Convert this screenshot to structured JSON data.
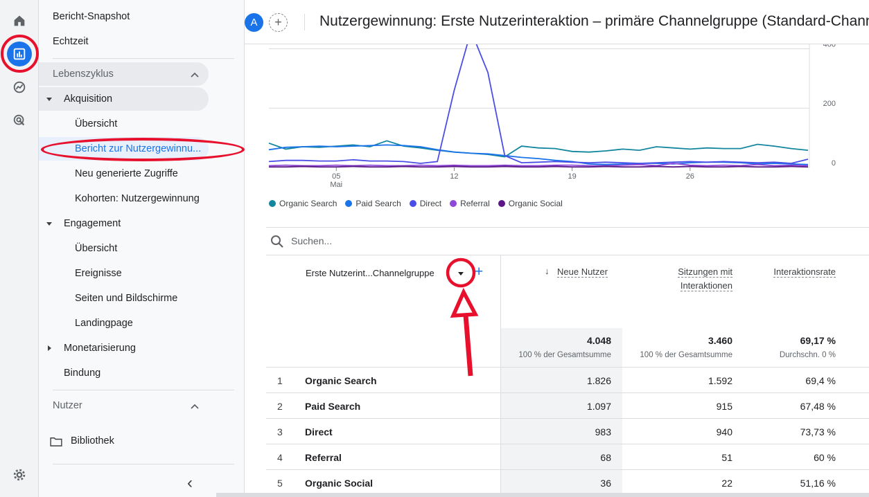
{
  "rail": {
    "icons": [
      "home-icon",
      "reports-icon",
      "explore-icon",
      "advertising-icon",
      "settings-icon"
    ]
  },
  "nav": {
    "top_items": [
      "Bericht-Snapshot",
      "Echtzeit"
    ],
    "lifecycle_label": "Lebenszyklus",
    "acquisition_label": "Akquisition",
    "acquisition_items": [
      "Übersicht",
      "Bericht zur Nutzergewinnu...",
      "Neu generierte Zugriffe",
      "Kohorten: Nutzergewinnung"
    ],
    "engagement_label": "Engagement",
    "engagement_items": [
      "Übersicht",
      "Ereignisse",
      "Seiten und Bildschirme",
      "Landingpage"
    ],
    "monetization_label": "Monetarisierung",
    "retention_label": "Bindung",
    "users_label": "Nutzer",
    "library_label": "Bibliothek",
    "collapse_label": "‹"
  },
  "header": {
    "avatar_letter": "A",
    "add_label": "+",
    "title": "Nutzergewinnung: Erste Nutzerinteraktion – primäre Channelgruppe (Standard-Channelgruppe)"
  },
  "chart_data": {
    "type": "line",
    "x_tick_labels": [
      "05",
      "12",
      "19",
      "26"
    ],
    "x_sublabel": "Mai",
    "y_tick_labels": [
      "400",
      "200",
      "0"
    ],
    "ylim": [
      0,
      450
    ],
    "colors": {
      "Organic Search": "#1a73e8",
      "Paid Search": "#1e6fd9",
      "Direct": "#4f46e5",
      "Referral": "#7c3aed",
      "Organic Social": "#6a1b9a"
    },
    "series": [
      {
        "name": "Organic Search",
        "color": "#12869f",
        "values": [
          82,
          62,
          70,
          68,
          72,
          76,
          70,
          90,
          72,
          66,
          58,
          52,
          48,
          44,
          36,
          72,
          66,
          64,
          54,
          52,
          56,
          62,
          58,
          70,
          66,
          62,
          66,
          64,
          64,
          78,
          72,
          64,
          58
        ]
      },
      {
        "name": "Paid Search",
        "color": "#1a73e8",
        "values": [
          60,
          68,
          70,
          72,
          70,
          72,
          74,
          76,
          74,
          70,
          60,
          52,
          48,
          46,
          40,
          34,
          30,
          24,
          20,
          12,
          10,
          12,
          14,
          14,
          12,
          16,
          18,
          18,
          16,
          12,
          14,
          12,
          10
        ]
      },
      {
        "name": "Direct",
        "color": "#4a4ee6",
        "values": [
          20,
          24,
          24,
          22,
          22,
          26,
          22,
          22,
          20,
          14,
          20,
          260,
          460,
          320,
          40,
          16,
          18,
          20,
          18,
          16,
          18,
          16,
          14,
          16,
          18,
          20,
          18,
          20,
          18,
          16,
          18,
          14,
          28
        ]
      },
      {
        "name": "Referral",
        "color": "#8e47d6",
        "values": [
          6,
          8,
          6,
          6,
          8,
          6,
          8,
          6,
          6,
          8,
          6,
          8,
          6,
          6,
          8,
          6,
          6,
          8,
          8,
          6,
          6,
          8,
          10,
          6,
          14,
          8,
          6,
          8,
          6,
          10,
          6,
          8,
          6
        ]
      },
      {
        "name": "Organic Social",
        "color": "#5b1687",
        "values": [
          2,
          2,
          4,
          2,
          2,
          4,
          2,
          2,
          4,
          2,
          2,
          4,
          2,
          2,
          4,
          2,
          2,
          4,
          2,
          2,
          4,
          2,
          2,
          4,
          2,
          4,
          2,
          2,
          4,
          2,
          2,
          4,
          2
        ]
      }
    ]
  },
  "table": {
    "search_placeholder": "Suchen...",
    "dimension_header": "Erste Nutzerint...Channelgruppe",
    "add_dimension": "+",
    "sort_arrow": "↓",
    "metrics": [
      {
        "header_line1": "Neue Nutzer",
        "header_line2": "",
        "total": "4.048",
        "total_sub": "100 % der Gesamtsumme"
      },
      {
        "header_line1": "Sitzungen mit",
        "header_line2": "Interaktionen",
        "total": "3.460",
        "total_sub": "100 % der Gesamtsumme"
      },
      {
        "header_line1": "Interaktionsrate",
        "header_line2": "",
        "total": "69,17 %",
        "total_sub": "Durchschn. 0 %"
      }
    ],
    "rows": [
      {
        "index": "1",
        "channel": "Organic Search",
        "new_users": "1.826",
        "sessions": "1.592",
        "rate": "69,4 %"
      },
      {
        "index": "2",
        "channel": "Paid Search",
        "new_users": "1.097",
        "sessions": "915",
        "rate": "67,48 %"
      },
      {
        "index": "3",
        "channel": "Direct",
        "new_users": "983",
        "sessions": "940",
        "rate": "73,73 %"
      },
      {
        "index": "4",
        "channel": "Referral",
        "new_users": "68",
        "sessions": "51",
        "rate": "60 %"
      },
      {
        "index": "5",
        "channel": "Organic Social",
        "new_users": "36",
        "sessions": "22",
        "rate": "51,16 %"
      }
    ]
  }
}
